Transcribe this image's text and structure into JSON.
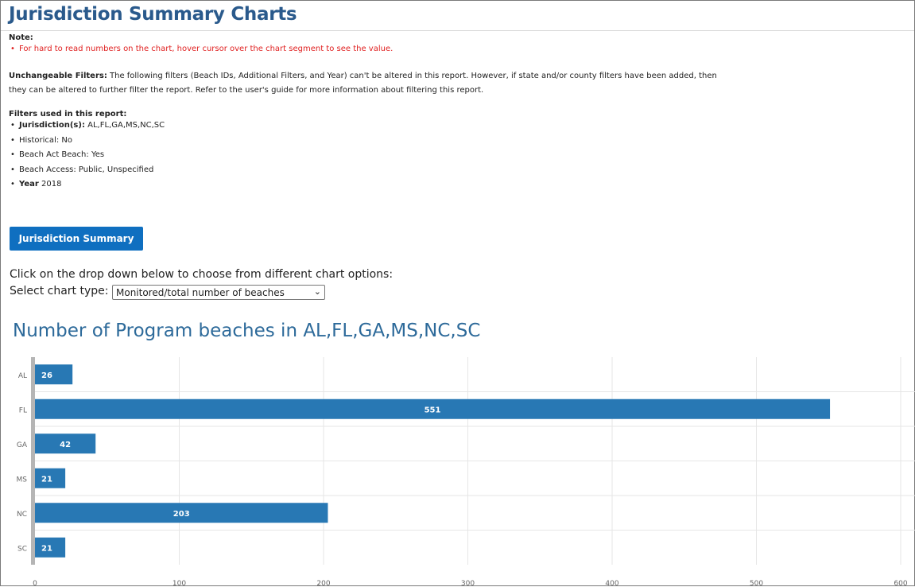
{
  "page": {
    "title": "Jurisdiction Summary Charts",
    "note_label": "Note:",
    "note_item": "For hard to read numbers on the chart, hover cursor over the chart segment to see the value.",
    "unchangeable_label": "Unchangeable Filters:",
    "unchangeable_text": " The following filters (Beach IDs, Additional Filters, and Year) can't be altered in this report. However, if state and/or county filters have been added, then they can be altered to further filter the report. Refer to the user's guide for more information about filtering this report.",
    "filters_label": "Filters used in this report:",
    "filters": [
      {
        "label": "Jurisdiction(s):",
        "value": " AL,FL,GA,MS,NC,SC"
      },
      {
        "label": "",
        "value": "Historical: No"
      },
      {
        "label": "",
        "value": "Beach Act Beach: Yes"
      },
      {
        "label": "",
        "value": "Beach Access: Public, Unspecified"
      },
      {
        "label": "Year",
        "value": " 2018"
      }
    ],
    "summary_button": "Jurisdiction Summary",
    "instructions": "Click on the drop down below to choose from different chart options:",
    "select_label": "Select chart type:",
    "select_value": "Monitored/total number of beaches",
    "bullet_icon": "•",
    "chevron_icon": "⌄"
  },
  "chart_data": {
    "type": "bar",
    "orientation": "horizontal",
    "title": "Number of Program beaches in AL,FL,GA,MS,NC,SC",
    "categories": [
      "AL",
      "FL",
      "GA",
      "MS",
      "NC",
      "SC"
    ],
    "values": [
      26,
      551,
      42,
      21,
      203,
      21
    ],
    "xlim": [
      0,
      600
    ],
    "xticks": [
      0,
      100,
      200,
      300,
      400,
      500,
      600
    ],
    "bar_color": "#2878b4",
    "grid": true
  }
}
